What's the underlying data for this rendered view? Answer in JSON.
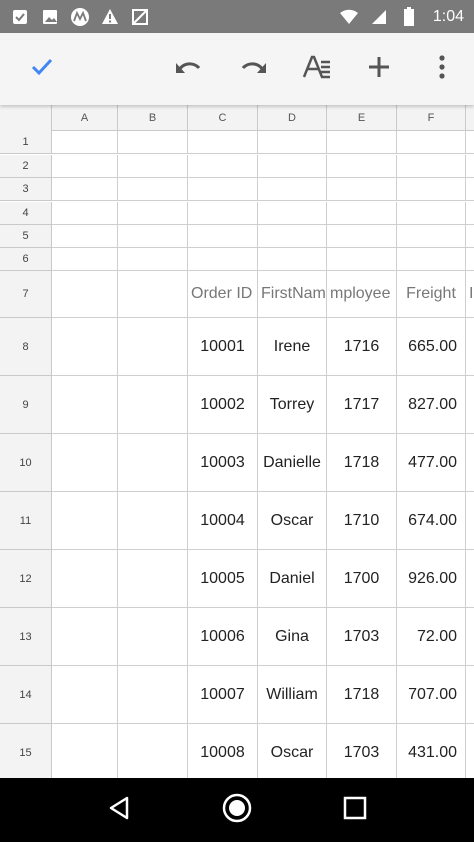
{
  "status_bar": {
    "time": "1:04",
    "left_icons": [
      "clipboard-notification-icon",
      "image-notification-icon",
      "motorola-icon",
      "warning-icon",
      "no-signal-icon"
    ],
    "right_icons": [
      "wifi-icon",
      "signal-icon",
      "battery-icon"
    ]
  },
  "toolbar": {
    "icons": [
      "check-icon",
      "undo-icon",
      "redo-icon",
      "text-format-icon",
      "add-icon",
      "more-vert-icon"
    ],
    "accent": "#4285f4"
  },
  "sheet": {
    "columns": [
      "A",
      "B",
      "C",
      "D",
      "E",
      "F"
    ],
    "rows": [
      "1",
      "2",
      "3",
      "4",
      "5",
      "6",
      "7",
      "8",
      "9",
      "10",
      "11",
      "12",
      "13",
      "14",
      "15"
    ],
    "header_row_values": {
      "order_id": "Order ID",
      "first_name": "FirstName",
      "employee": "mployee I",
      "freight": "Freight",
      "overflow": "I"
    },
    "data": [
      {
        "order": "10001",
        "name": "Irene",
        "emp": "1716",
        "freight": "665.00"
      },
      {
        "order": "10002",
        "name": "Torrey",
        "emp": "1717",
        "freight": "827.00"
      },
      {
        "order": "10003",
        "name": "Danielle",
        "emp": "1718",
        "freight": "477.00"
      },
      {
        "order": "10004",
        "name": "Oscar",
        "emp": "1710",
        "freight": "674.00"
      },
      {
        "order": "10005",
        "name": "Daniel",
        "emp": "1700",
        "freight": "926.00"
      },
      {
        "order": "10006",
        "name": "Gina",
        "emp": "1703",
        "freight": "72.00"
      },
      {
        "order": "10007",
        "name": "William",
        "emp": "1718",
        "freight": "707.00"
      },
      {
        "order": "10008",
        "name": "Oscar",
        "emp": "1703",
        "freight": "431.00"
      }
    ]
  },
  "nav": {
    "icons": [
      "back-icon",
      "home-icon",
      "recents-icon"
    ]
  }
}
